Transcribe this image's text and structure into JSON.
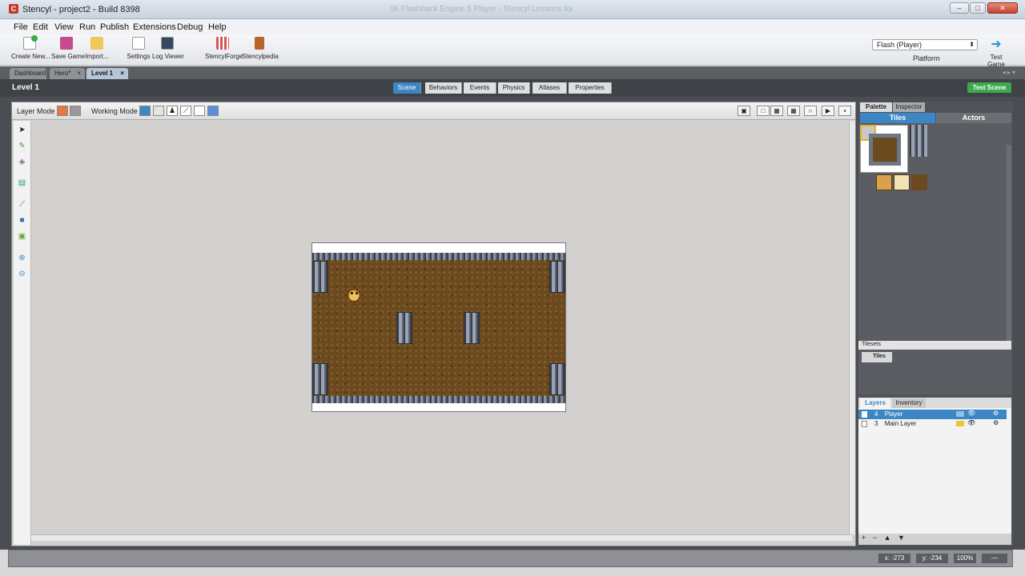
{
  "window": {
    "title": "Stencyl - project2 - Build 8398",
    "ghost_title": "06 Flashback Engine 5 Player - Stencyl Lessons for",
    "controls": [
      "–",
      "□",
      "✕"
    ]
  },
  "menu": [
    "File",
    "Edit",
    "View",
    "Run",
    "Publish",
    "Extensions",
    "Debug",
    "Help"
  ],
  "toolbar": {
    "create_new": "Create New...",
    "save_game": "Save Game",
    "import": "Import...",
    "settings": "Settings",
    "log_viewer": "Log Viewer",
    "stencylforge": "StencylForge",
    "stencylpedia": "Stencylpedia",
    "platform_value": "Flash (Player)",
    "platform_label": "Platform",
    "test_game": "Test Game"
  },
  "tabs": [
    {
      "label": "Dashboard",
      "closable": false
    },
    {
      "label": "Hero*",
      "closable": true
    },
    {
      "label": "Level 1",
      "closable": true,
      "active": true
    }
  ],
  "scene": {
    "title": "Level 1",
    "tabs": [
      "Scene",
      "Behaviors",
      "Events",
      "Physics",
      "Atlases",
      "Properties"
    ],
    "active_tab": "Scene",
    "test_scene": "Test Scene"
  },
  "modebar": {
    "layer_mode": "Layer Mode",
    "working_mode": "Working Mode"
  },
  "palette": {
    "tabs": [
      "Palette",
      "Inspector"
    ],
    "segments": [
      "Tiles",
      "Actors"
    ],
    "active_segment": "Tiles"
  },
  "tilesets": {
    "header": "Tilesets",
    "item": "Tiles"
  },
  "layers": {
    "tabs": [
      "Layers",
      "Inventory"
    ],
    "rows": [
      {
        "order": "4",
        "name": "Player",
        "selected": true,
        "color": "#4a90d9"
      },
      {
        "order": "3",
        "name": "Main Layer",
        "selected": false,
        "color": "#f2c230"
      }
    ]
  },
  "status": {
    "x": "x: -273",
    "y": "y: -234",
    "zoom": "100%",
    "dash": "—"
  },
  "colors": {
    "accent": "#3d86c6",
    "test_scene_green": "#3ea84e"
  }
}
